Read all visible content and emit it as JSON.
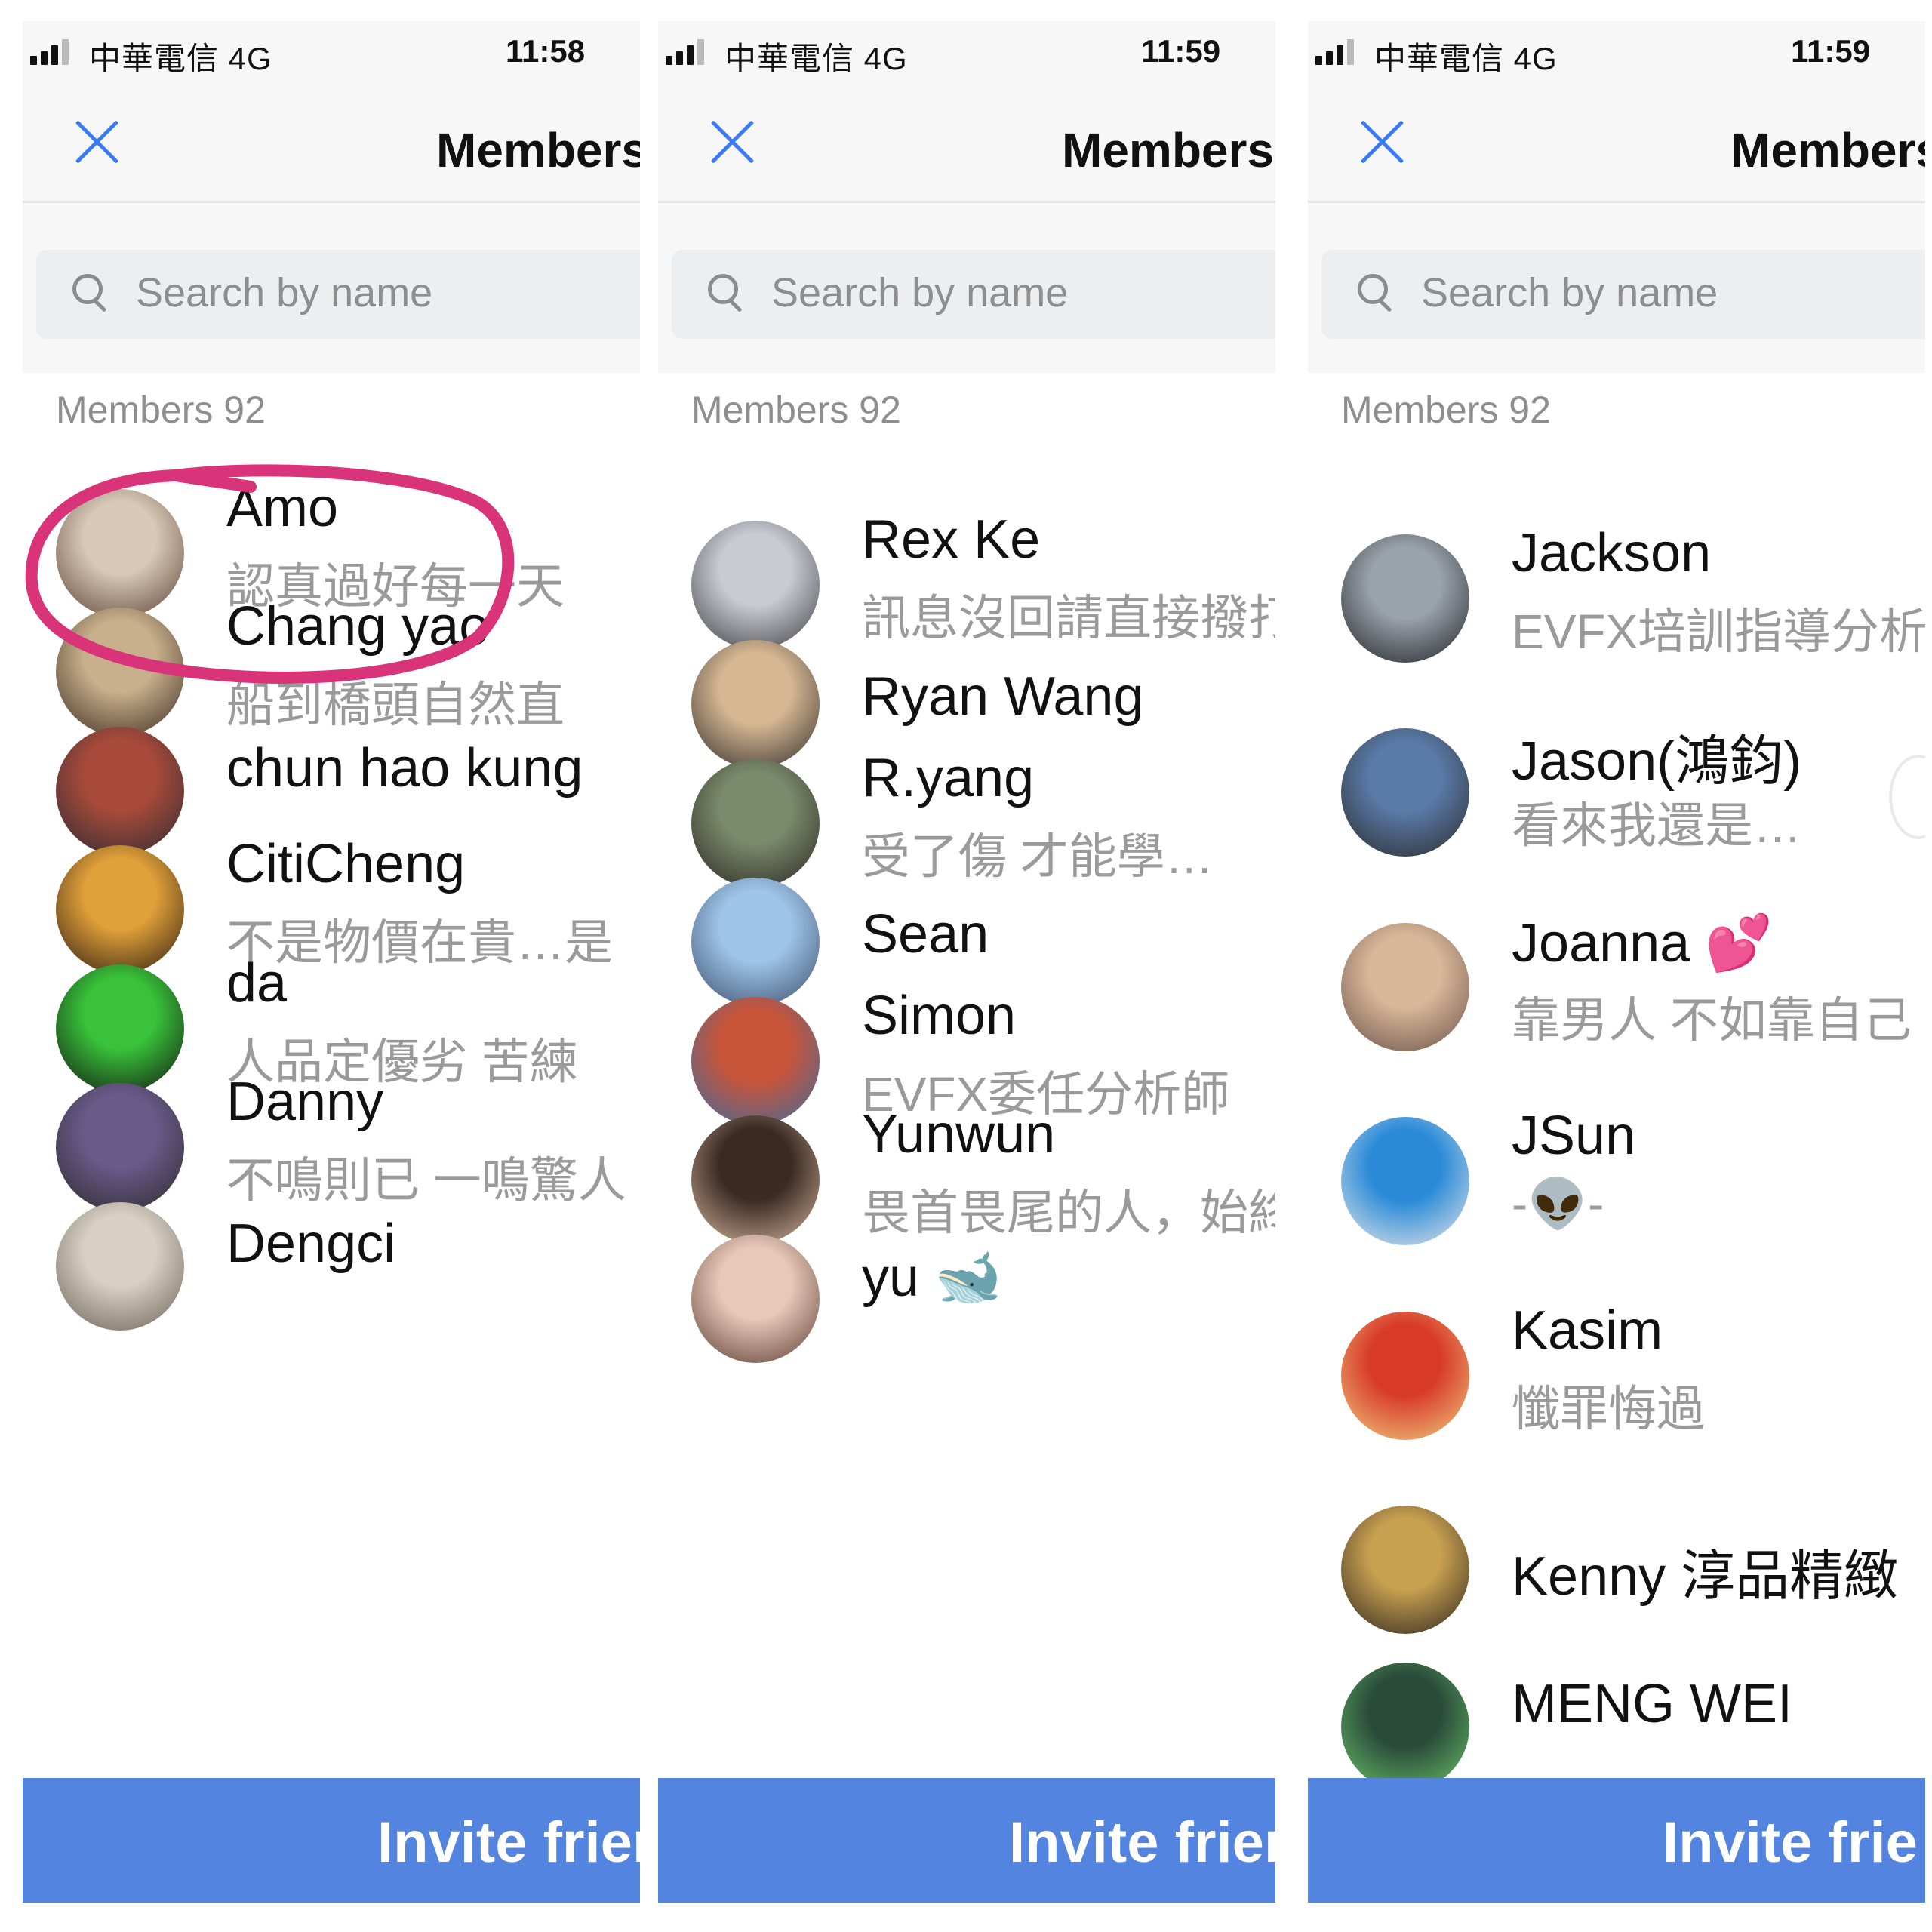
{
  "status_bar": {
    "carrier": "中華電信  4G"
  },
  "panels": [
    {
      "time": "11:58",
      "title": "Members",
      "search_placeholder": "Search by name",
      "section_label": "Members 92",
      "invite_label": "Invite frien",
      "members": [
        {
          "name": "Amo",
          "status": "認真過好每一天",
          "avatar_colors": [
            "#d9c9b8",
            "#5a4132"
          ]
        },
        {
          "name": "Chang yao",
          "status": "船到橋頭自然直",
          "avatar_colors": [
            "#c9b08c",
            "#3a2a20"
          ]
        },
        {
          "name": "chun hao kung",
          "status": "",
          "avatar_colors": [
            "#a84a3a",
            "#2b2b33"
          ]
        },
        {
          "name": "CitiCheng",
          "status": "不是物價在貴…是",
          "avatar_colors": [
            "#e0a03a",
            "#2a1a10"
          ]
        },
        {
          "name": "da",
          "status": "人品定優劣 苦練",
          "avatar_colors": [
            "#39c23a",
            "#111111"
          ]
        },
        {
          "name": "Danny",
          "status": "不鳴則已 一鳴驚人",
          "avatar_colors": [
            "#6a5a8a",
            "#2a2a2a"
          ]
        },
        {
          "name": "Dengci",
          "status": "",
          "avatar_colors": [
            "#d8d0c4",
            "#6a6055"
          ]
        }
      ]
    },
    {
      "time": "11:59",
      "title": "Members",
      "search_placeholder": "Search by name",
      "section_label": "Members 92",
      "invite_label": "Invite frien",
      "members": [
        {
          "name": "Rex Ke",
          "status": "訊息沒回請直接撥打",
          "avatar_colors": [
            "#c8ccd2",
            "#3a3a40"
          ]
        },
        {
          "name": "Ryan Wang",
          "status": "",
          "avatar_colors": [
            "#d6b792",
            "#2d2a2a"
          ]
        },
        {
          "name": "R.yang",
          "status": "受了傷 才能學…",
          "avatar_colors": [
            "#7a8a6a",
            "#2a2522"
          ]
        },
        {
          "name": "Sean",
          "status": "",
          "avatar_colors": [
            "#9ec4e8",
            "#3a4a66"
          ]
        },
        {
          "name": "Simon",
          "status": "EVFX委任分析師",
          "avatar_colors": [
            "#c8553a",
            "#3a6aa0"
          ]
        },
        {
          "name": "Yunwun",
          "status": "畏首畏尾的人，始終",
          "avatar_colors": [
            "#3a2a22",
            "#d8b8a0"
          ]
        },
        {
          "name": "yu 🐋",
          "status": "",
          "avatar_colors": [
            "#e8c8b8",
            "#5a3a30"
          ]
        }
      ]
    },
    {
      "time": "11:59",
      "title": "Members",
      "search_placeholder": "Search by name",
      "section_label": "Members 92",
      "invite_label": "Invite frie",
      "members": [
        {
          "name": "Jackson",
          "status": "EVFX培訓指導分析",
          "avatar_colors": [
            "#9aa2aa",
            "#1f2226"
          ]
        },
        {
          "name": "Jason(鴻鈞)",
          "status": "看來我還是…",
          "avatar_colors": [
            "#5a7aa8",
            "#2a2a2a"
          ]
        },
        {
          "name": "Joanna 💕",
          "status": "靠男人 不如靠自己",
          "avatar_colors": [
            "#d8b89a",
            "#6a5048"
          ]
        },
        {
          "name": "JSun",
          "status": "-👽-",
          "avatar_colors": [
            "#2a8ad8",
            "#e8e8e8"
          ]
        },
        {
          "name": "Kasim",
          "status": "懺罪悔過",
          "avatar_colors": [
            "#d83a2a",
            "#f0d080"
          ]
        },
        {
          "name": "Kenny 淳品精緻",
          "status": "",
          "avatar_colors": [
            "#c8a050",
            "#2a2420"
          ]
        },
        {
          "name": "MENG WEI",
          "status": "",
          "avatar_colors": [
            "#2a4a3a",
            "#6ac86a"
          ]
        }
      ]
    }
  ],
  "annotation": {
    "highlight_color": "#d9337a"
  }
}
